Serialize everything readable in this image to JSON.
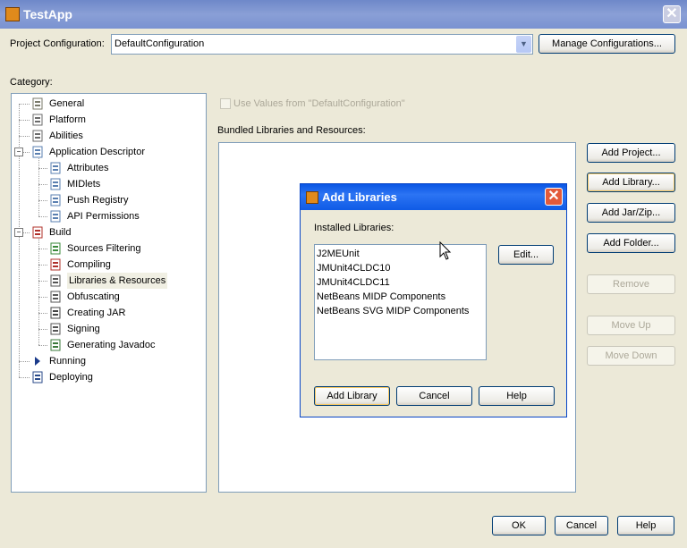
{
  "window": {
    "title": "TestApp",
    "close_glyph": "✕"
  },
  "config": {
    "label": "Project Configuration:",
    "value": "DefaultConfiguration",
    "manage_button": "Manage Configurations..."
  },
  "category_label": "Category:",
  "tree": [
    {
      "label": "General",
      "icon": "general-icon",
      "level": 1
    },
    {
      "label": "Platform",
      "icon": "platform-icon",
      "level": 1
    },
    {
      "label": "Abilities",
      "icon": "abilities-icon",
      "level": 1
    },
    {
      "label": "Application Descriptor",
      "icon": "descriptor-icon",
      "level": 1
    },
    {
      "label": "Attributes",
      "icon": "document-icon",
      "level": 2
    },
    {
      "label": "MIDlets",
      "icon": "document-icon",
      "level": 2
    },
    {
      "label": "Push Registry",
      "icon": "document-icon",
      "level": 2
    },
    {
      "label": "API Permissions",
      "icon": "document-icon",
      "level": 2
    },
    {
      "label": "Build",
      "icon": "build-icon",
      "level": 1
    },
    {
      "label": "Sources Filtering",
      "icon": "filter-icon",
      "level": 2
    },
    {
      "label": "Compiling",
      "icon": "compile-icon",
      "level": 2
    },
    {
      "label": "Libraries & Resources",
      "icon": "libraries-icon",
      "level": 2,
      "selected": true
    },
    {
      "label": "Obfuscating",
      "icon": "obfuscate-icon",
      "level": 2
    },
    {
      "label": "Creating JAR",
      "icon": "jar-icon",
      "level": 2
    },
    {
      "label": "Signing",
      "icon": "signing-icon",
      "level": 2
    },
    {
      "label": "Generating Javadoc",
      "icon": "javadoc-icon",
      "level": 2
    },
    {
      "label": "Running",
      "icon": "run-arrow-icon",
      "level": 1
    },
    {
      "label": "Deploying",
      "icon": "deploy-icon",
      "level": 1
    }
  ],
  "right": {
    "use_values_label": "Use Values from \"DefaultConfiguration\"",
    "bundled_label": "Bundled Libraries and Resources:",
    "buttons": {
      "add_project": "Add Project...",
      "add_library": "Add Library...",
      "add_jar": "Add Jar/Zip...",
      "add_folder": "Add Folder...",
      "remove": "Remove",
      "move_up": "Move Up",
      "move_down": "Move Down"
    }
  },
  "dialog": {
    "title": "Add Libraries",
    "installed_label": "Installed Libraries:",
    "libraries": [
      "J2MEUnit",
      "JMUnit4CLDC10",
      "JMUnit4CLDC11",
      "NetBeans MIDP Components",
      "NetBeans SVG MIDP Components"
    ],
    "edit_button": "Edit...",
    "add_library_button": "Add Library",
    "cancel_button": "Cancel",
    "help_button": "Help"
  },
  "footer": {
    "ok": "OK",
    "cancel": "Cancel",
    "help": "Help"
  }
}
